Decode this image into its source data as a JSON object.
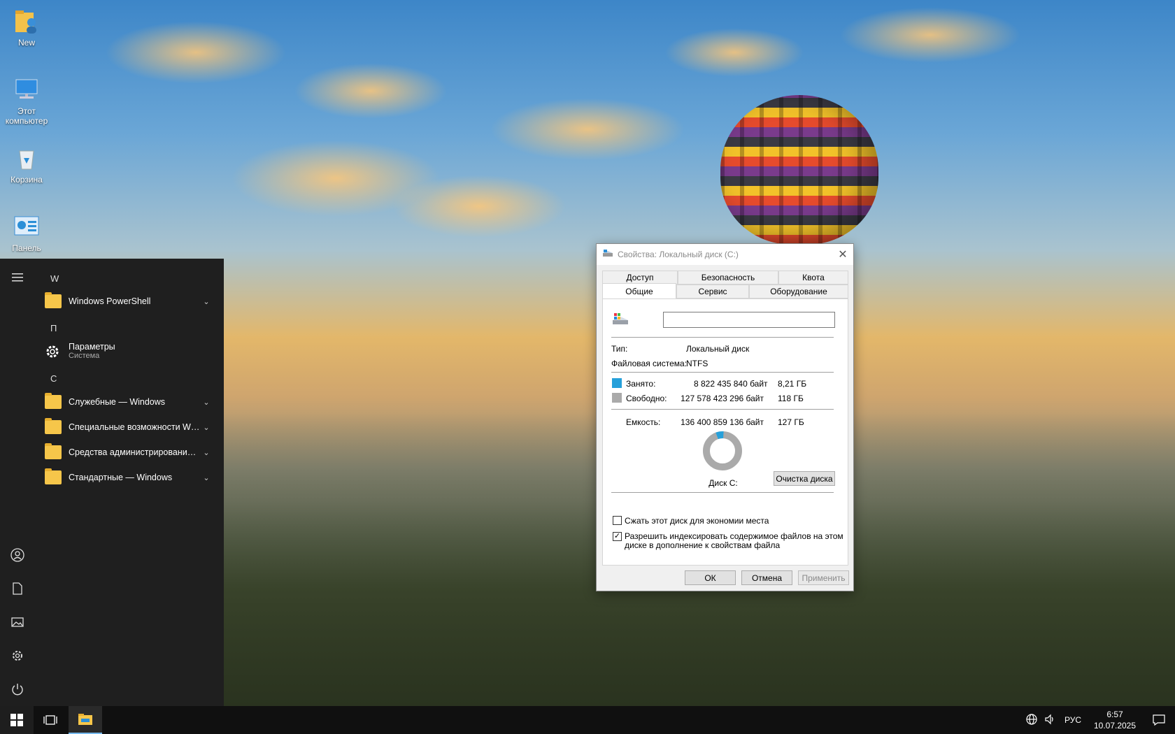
{
  "desktop": {
    "icons": [
      {
        "label": "New",
        "icon": "user-folder-icon"
      },
      {
        "label": "Этот компьютер",
        "icon": "computer-icon"
      },
      {
        "label": "Корзина",
        "icon": "recycle-bin-icon"
      },
      {
        "label": "Панель",
        "icon": "control-panel-icon"
      }
    ]
  },
  "start_menu": {
    "sections": [
      {
        "letter": "W"
      },
      {
        "letter": "П"
      },
      {
        "letter": "С"
      }
    ],
    "items": [
      {
        "label": "Windows PowerShell",
        "icon": "folder-icon"
      },
      {
        "label": "Параметры",
        "sub": "Система",
        "icon": "gear-icon"
      },
      {
        "label": "Служебные — Windows",
        "icon": "folder-icon"
      },
      {
        "label": "Специальные возможности Win...",
        "icon": "folder-icon"
      },
      {
        "label": "Средства администрирования W...",
        "icon": "folder-icon"
      },
      {
        "label": "Стандартные — Windows",
        "icon": "folder-icon"
      }
    ],
    "rail": [
      "hamburger-icon",
      "user-icon",
      "document-icon",
      "pictures-icon",
      "settings-icon",
      "power-icon"
    ]
  },
  "dialog": {
    "title": "Свойства: Локальный диск (C:)",
    "tabs_top": [
      "Доступ",
      "Безопасность",
      "Квота"
    ],
    "tabs_bottom": [
      "Общие",
      "Сервис",
      "Оборудование"
    ],
    "active_tab": "Общие",
    "name_value": "",
    "type_label": "Тип:",
    "type_value": "Локальный диск",
    "fs_label": "Файловая система:",
    "fs_value": "NTFS",
    "used_label": "Занято:",
    "used_bytes": "8 822 435 840 байт",
    "used_size": "8,21 ГБ",
    "free_label": "Свободно:",
    "free_bytes": "127 578 423 296 байт",
    "free_size": "118 ГБ",
    "capacity_label": "Емкость:",
    "capacity_bytes": "136 400 859 136 байт",
    "capacity_size": "127 ГБ",
    "used_fraction": 0.0647,
    "drive_label": "Диск C:",
    "cleanup_button": "Очистка диска",
    "compress_label": "Сжать этот диск для экономии места",
    "compress_checked": false,
    "index_label_line1": "Разрешить индексировать содержимое файлов на этом",
    "index_label_line2": "диске в дополнение к свойствам файла",
    "index_checked": true,
    "ok": "ОК",
    "cancel": "Отмена",
    "apply": "Применить",
    "colors": {
      "used": "#26a0da",
      "free": "#aaaaaa"
    }
  },
  "taskbar": {
    "lang": "РУС",
    "time": "6:57",
    "date": "10.07.2025"
  }
}
